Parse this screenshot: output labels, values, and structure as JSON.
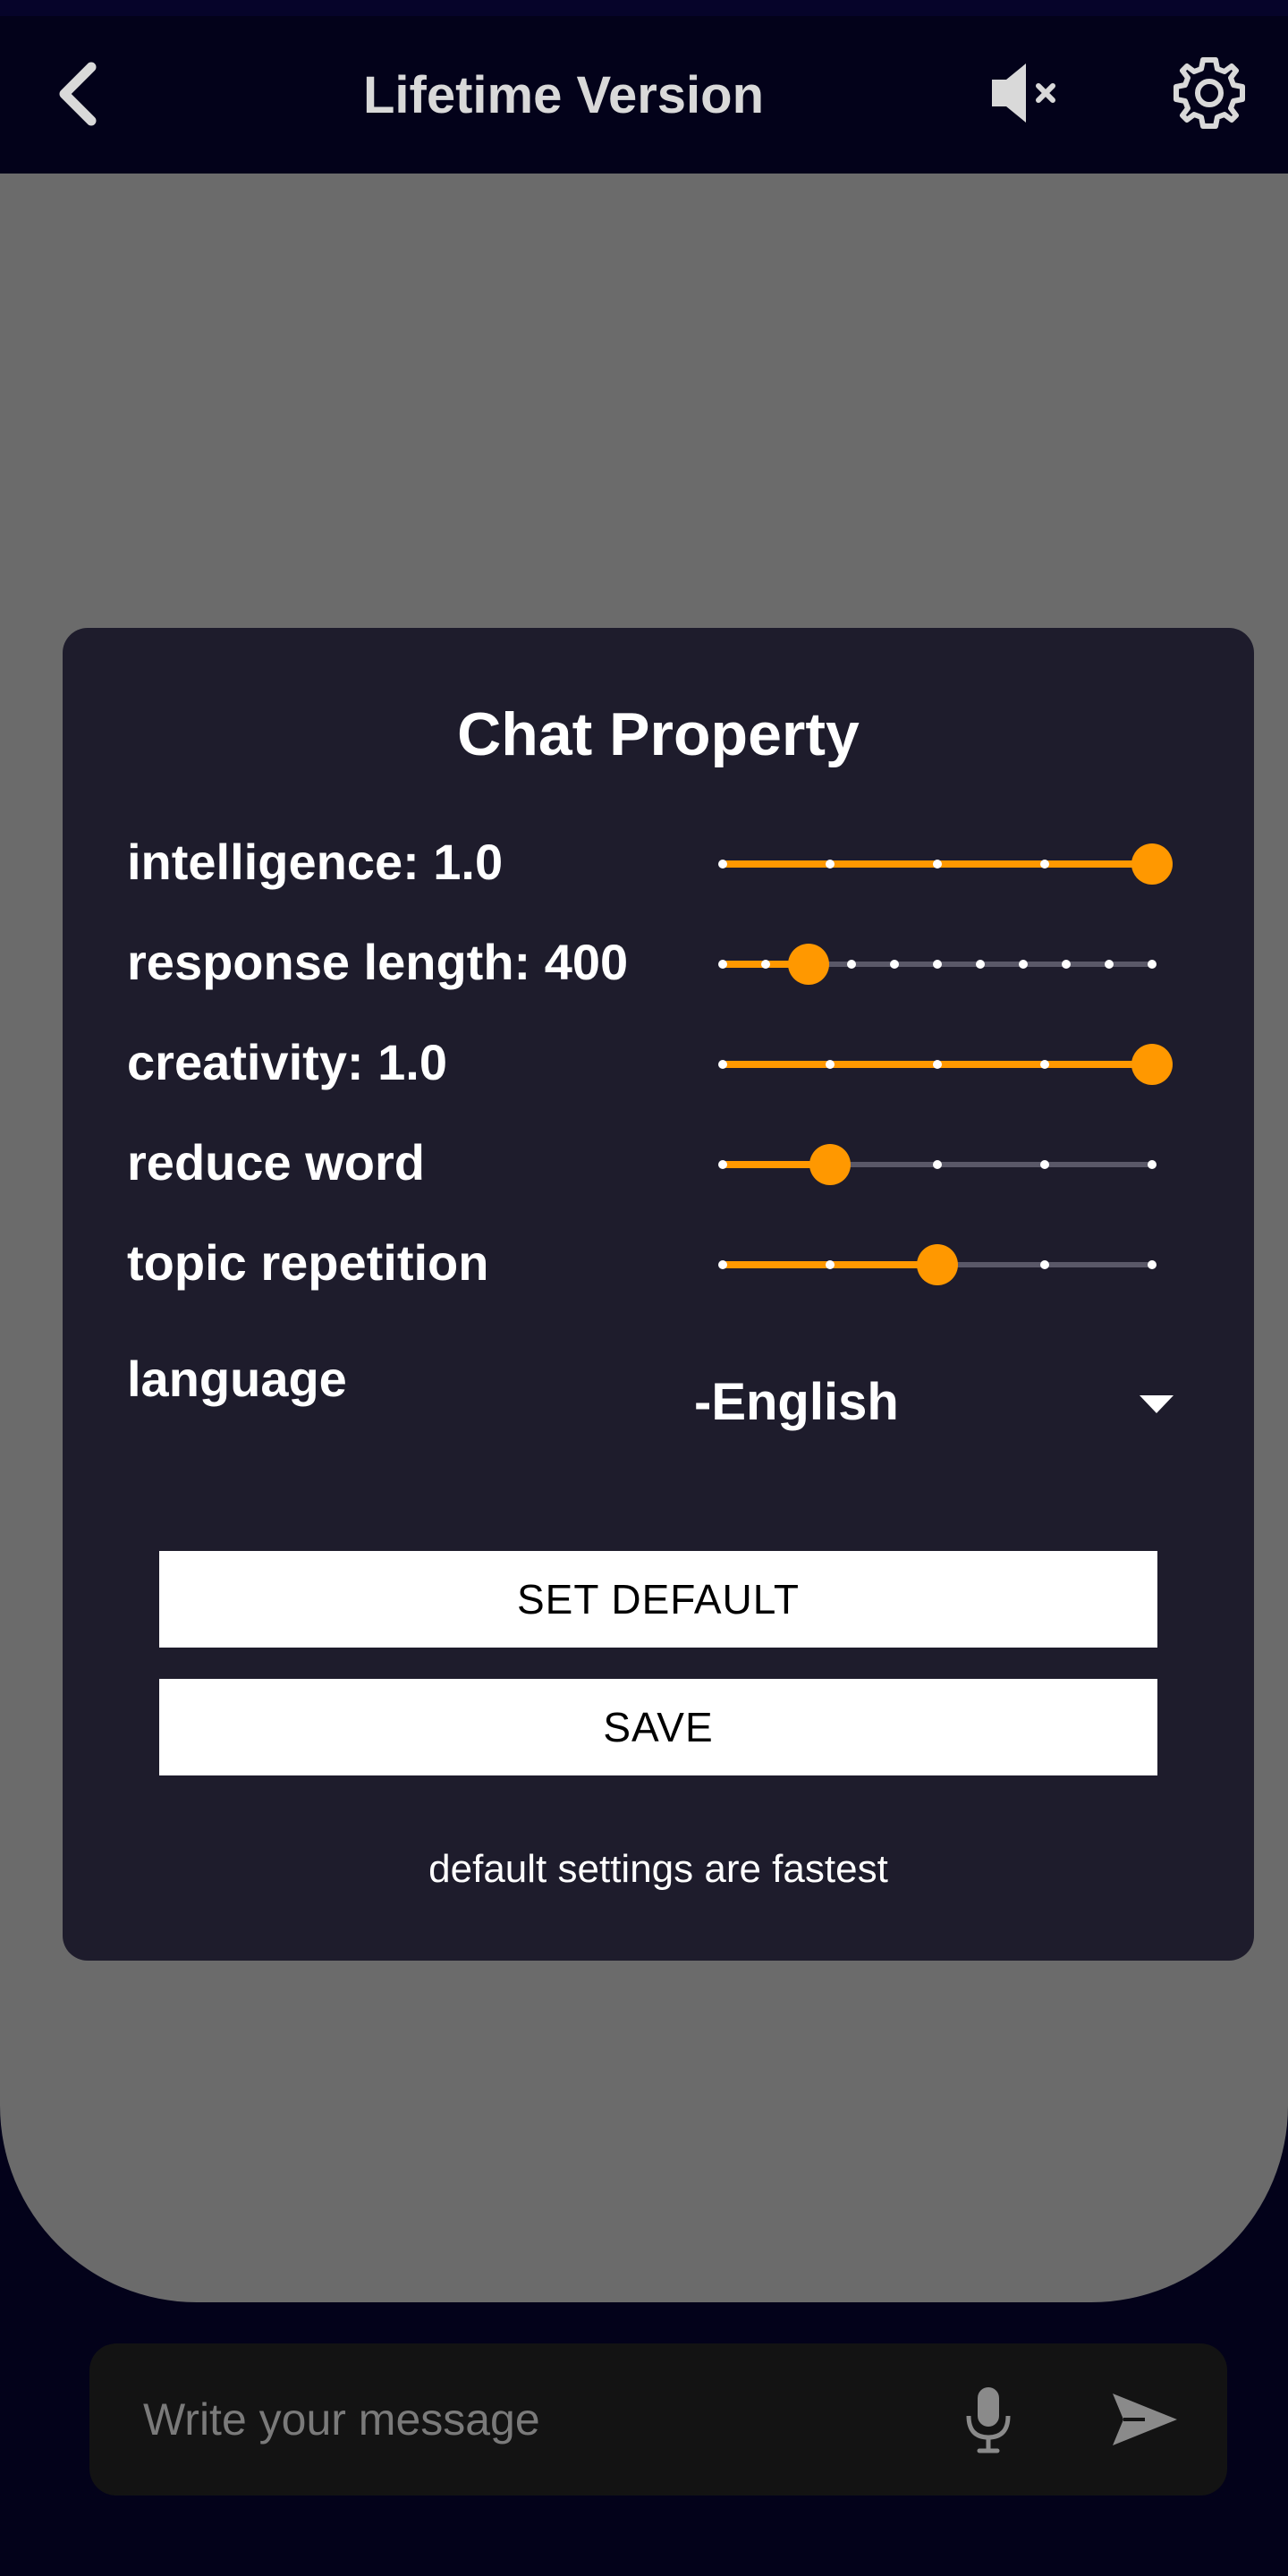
{
  "header": {
    "title": "Lifetime Version",
    "icons": [
      "chevron-left-icon",
      "speaker-muted-icon",
      "gear-icon"
    ]
  },
  "dialog": {
    "title": "Chat Property",
    "settings": [
      {
        "label": "intelligence: 1.0",
        "steps": 5,
        "selected_index": 4
      },
      {
        "label": "response length: 400",
        "steps": 11,
        "selected_index": 2
      },
      {
        "label": "creativity: 1.0",
        "steps": 5,
        "selected_index": 4
      },
      {
        "label": "reduce word",
        "steps": 5,
        "selected_index": 1
      },
      {
        "label": "topic repetition",
        "steps": 5,
        "selected_index": 2
      }
    ],
    "language": {
      "label": "language",
      "value": "-English"
    },
    "set_default_label": "SET DEFAULT",
    "save_label": "SAVE",
    "hint": "default settings are fastest"
  },
  "input": {
    "placeholder": "Write your message",
    "icons": [
      "microphone-icon",
      "send-icon"
    ]
  },
  "colors": {
    "background": "#03021a",
    "dialog": "#1e1c2c",
    "accent": "#ff9800",
    "track": "#5a5868",
    "overlay": "#6b6b6b"
  }
}
